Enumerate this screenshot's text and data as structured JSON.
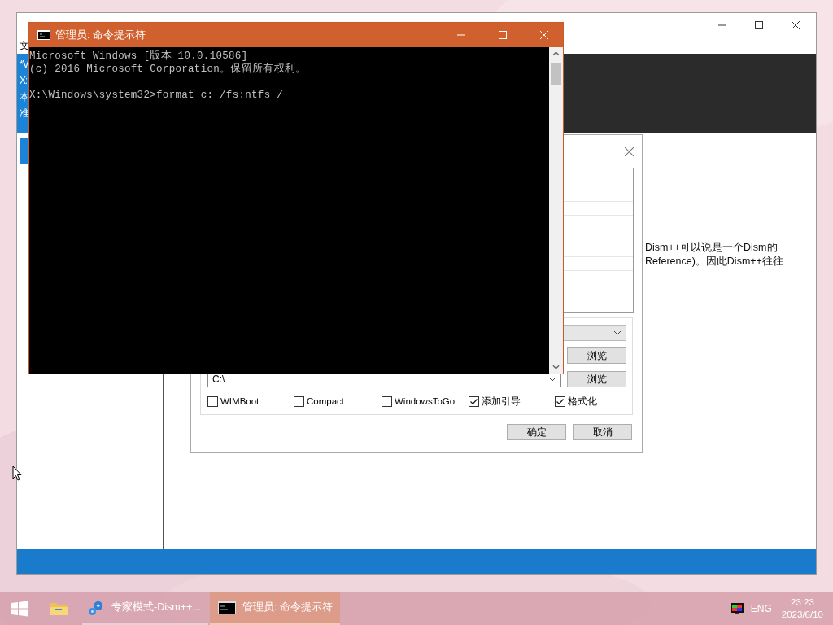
{
  "back_window": {
    "side_fragments": [
      "文",
      "*V",
      "X:",
      "本",
      "准"
    ],
    "description_lines": [
      "Dism++可以说是一个Dism的",
      "Reference)。因此Dism++往往"
    ]
  },
  "dialog": {
    "path_value": "C:\\",
    "browse_buttons": [
      "浏览",
      "浏览"
    ],
    "options": [
      {
        "label": "WIMBoot",
        "checked": false
      },
      {
        "label": "Compact",
        "checked": false
      },
      {
        "label": "WindowsToGo",
        "checked": false
      },
      {
        "label": "添加引导",
        "checked": true
      },
      {
        "label": "格式化",
        "checked": true
      }
    ],
    "buttons": [
      "确定",
      "取消"
    ]
  },
  "cmd": {
    "title": "管理员: 命令提示符",
    "banner": [
      "Microsoft Windows [版本 10.0.10586]",
      "(c) 2016 Microsoft Corporation。保留所有权利。"
    ],
    "prompt": "X:\\Windows\\system32>format c: /fs:ntfs /"
  },
  "taskbar": {
    "tasks": [
      {
        "label": "专家模式-Dism++...",
        "selected": false,
        "kind": "gear"
      },
      {
        "label": "管理员: 命令提示符",
        "selected": true,
        "kind": "console"
      }
    ],
    "language": "ENG",
    "time": "23:23",
    "date": "2023/6/10"
  }
}
